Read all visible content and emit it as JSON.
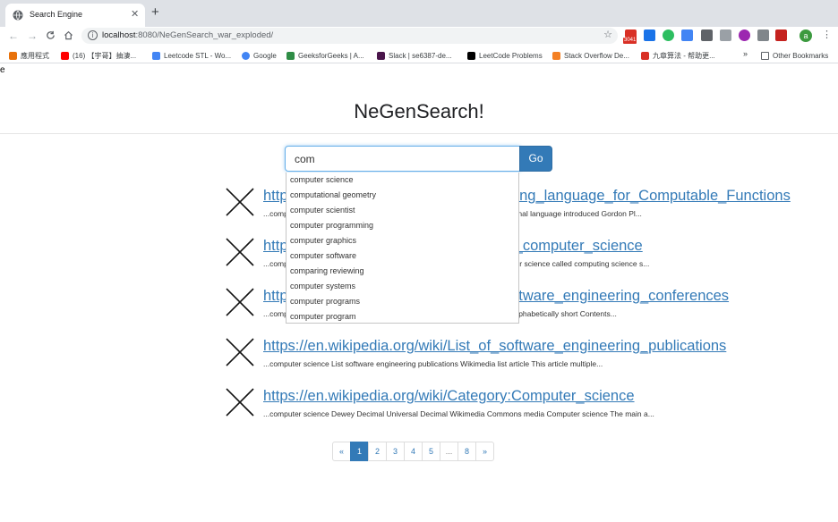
{
  "browser": {
    "tab_title": "Search Engine",
    "tab_close": "✕",
    "new_tab": "+",
    "url_host": "localhost",
    "url_path": ":8080/NeGenSearch_war_exploded/",
    "extension_badge": "3041",
    "profile_initial": "a"
  },
  "bookmarks": {
    "items": [
      {
        "label": "應用程式",
        "color": "#e8710a"
      },
      {
        "label": "(16) 【宇哥】抽淒...",
        "color": "#ff0000"
      },
      {
        "label": "Leetcode STL - Wo...",
        "color": "#4285f4"
      },
      {
        "label": "Google",
        "color": "#4285f4"
      },
      {
        "label": "GeeksforGeeks | A...",
        "color": "#2f8d46"
      },
      {
        "label": "Slack | se6387-de...",
        "color": "#4a154b"
      },
      {
        "label": "LeetCode Problems",
        "color": "#000000"
      },
      {
        "label": "Stack Overflow De...",
        "color": "#f48024"
      },
      {
        "label": "九章算法 - 帮助更...",
        "color": "#d93025"
      }
    ],
    "more": "»",
    "other_label": "Other Bookmarks"
  },
  "page": {
    "stray_text": "e",
    "title": "NeGenSearch!",
    "search_value": "com",
    "go_label": "Go"
  },
  "autocomplete": [
    "computer science",
    "computational geometry",
    "computer scientist",
    "computer programming",
    "computer graphics",
    "computer software",
    "comparing reviewing",
    "computer systems",
    "computer programs",
    "computer program"
  ],
  "results": [
    {
      "link": "https://en.wikipedia.org/wiki/Programming_language_for_Computable_Functions",
      "snippet": "...computer science Programming Computable Functions PCF typed functional language introduced Gordon Pl..."
    },
    {
      "link": "https://en.wikipedia.org/wiki/Outline_of_computer_science",
      "snippet": "...computer science Outline computer science Wikimedia list article computer science called computing science s..."
    },
    {
      "link": "https://en.wikipedia.org/wiki/List_of_software_engineering_conferences",
      "snippet": "...computer science List software engineering conferences This list sorted alphabetically short Contents..."
    },
    {
      "link": "https://en.wikipedia.org/wiki/List_of_software_engineering_publications",
      "snippet": "...computer science List software engineering publications Wikimedia list article This article multiple..."
    },
    {
      "link": "https://en.wikipedia.org/wiki/Category:Computer_science",
      "snippet": "...computer science Dewey Decimal Universal Decimal Wikimedia Commons media Computer science The main a..."
    }
  ],
  "pagination": {
    "prev": "«",
    "pages": [
      "1",
      "2",
      "3",
      "4",
      "5",
      "...",
      "8"
    ],
    "active": "1",
    "next": "»"
  }
}
